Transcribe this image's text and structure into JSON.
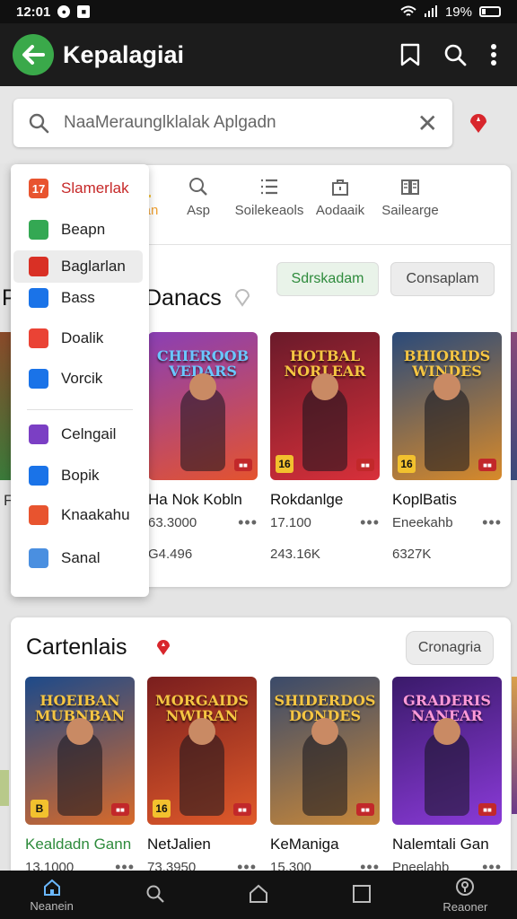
{
  "status_bar": {
    "time": "12:01",
    "battery": "19%"
  },
  "app_bar": {
    "title": "Kepalagiai"
  },
  "search": {
    "placeholder": "NaaMeraunglklalak Aplgadn"
  },
  "tabs": [
    {
      "label": "an",
      "icon": "tab-partial-icon"
    },
    {
      "label": "Asp",
      "icon": "search-icon"
    },
    {
      "label": "Soilekeaols",
      "icon": "list-icon"
    },
    {
      "label": "Aodaaik",
      "icon": "bag-icon"
    },
    {
      "label": "Sailearge",
      "icon": "book-icon"
    }
  ],
  "dropdown": {
    "items": [
      {
        "label": "Slamerlak",
        "icon": "home-icon",
        "color": "#e8542f",
        "accent": "#c62828"
      },
      {
        "label": "Beapn",
        "icon": "star-icon",
        "color": "#34a853"
      },
      {
        "label": "Baglarlan",
        "icon": "cross-icon",
        "color": "#d93025",
        "selected": true
      },
      {
        "label": "Bass",
        "icon": "book-icon",
        "color": "#1a73e8"
      },
      {
        "label": "Doalik",
        "icon": "film-icon",
        "color": "#ea4335"
      },
      {
        "label": "Vorcik",
        "icon": "calendar-icon",
        "color": "#1a73e8"
      },
      {
        "label": "Celngail",
        "icon": "palette-icon",
        "color": "#7b3fc4"
      },
      {
        "label": "Bopik",
        "icon": "briefcase-icon",
        "color": "#1a73e8"
      },
      {
        "label": "Knaakahu",
        "icon": "gift-icon",
        "color": "#e8542f"
      },
      {
        "label": "Sanal",
        "icon": "card-icon",
        "color": "#4a8fe0"
      }
    ]
  },
  "section1": {
    "title": "Danacs",
    "title_prefix": "P",
    "chip_primary": "Sdrskadam",
    "chip_secondary": "Consaplam",
    "cards": [
      {
        "name": "Ha Nok Kobln",
        "rating": "63.3000",
        "size": "G4.496",
        "logo": "CHIEROOB VEDARS",
        "rating_badge": "",
        "bg": [
          "#8a3fb5",
          "#e4532e"
        ],
        "logo_color": "#6ac7ff"
      },
      {
        "name": "Rokdanlge",
        "rating": "17.100",
        "size": "243.16K",
        "logo": "HOTBAL NORLEAR",
        "rating_badge": "16",
        "bg": [
          "#6a1a2a",
          "#d8303a"
        ],
        "logo_color": "#f5c542"
      },
      {
        "name": "KoplBatis",
        "rating": "Eneekahb",
        "size": "6327K",
        "logo": "BHIORIDS WINDES",
        "rating_badge": "16",
        "bg": [
          "#2a4a7a",
          "#d88a2a"
        ],
        "logo_color": "#f5c542"
      }
    ],
    "left_partial": {
      "label": "F",
      "size": "F"
    }
  },
  "section2": {
    "title": "Cartenlais",
    "chip": "Cronagria",
    "cards": [
      {
        "name": "Kealdadn Gann",
        "rating": "13.1000",
        "logo": "HOEIBAN MUBNBAN",
        "rating_badge": "B",
        "bg": [
          "#1d4a8a",
          "#d86a2a"
        ],
        "logo_color": "#f5c542",
        "name_color": "#2e8b3c"
      },
      {
        "name": "NetJalien",
        "rating": "73.3950",
        "logo": "MORGAIDS NWIRAN",
        "rating_badge": "16",
        "bg": [
          "#7a1e1e",
          "#e05a2a"
        ],
        "logo_color": "#f5c542",
        "name_color": "#111"
      },
      {
        "name": "KeManiga",
        "rating": "15.300",
        "logo": "SHIDERDOS DONDES",
        "rating_badge": "",
        "bg": [
          "#3a4a6a",
          "#c8883a"
        ],
        "logo_color": "#f5c542",
        "name_color": "#111"
      },
      {
        "name": "Nalemtali Gan",
        "rating": "Pneelahb",
        "logo": "GRADERIS NANEAR",
        "rating_badge": "",
        "bg": [
          "#3a1a6a",
          "#8a3ad8"
        ],
        "logo_color": "#ff9ad8",
        "name_color": "#111"
      }
    ]
  },
  "bottom_nav": [
    {
      "label": "Neanein",
      "icon": "home-icon",
      "active": true
    },
    {
      "label": "",
      "icon": "search-icon"
    },
    {
      "label": "",
      "icon": "home-outline-icon"
    },
    {
      "label": "",
      "icon": "square-icon"
    },
    {
      "label": "Reaoner",
      "icon": "location-icon"
    }
  ],
  "colors": {
    "accent_green": "#3aa94a",
    "dark": "#1c1c1c",
    "pin_red": "#d8262c"
  }
}
